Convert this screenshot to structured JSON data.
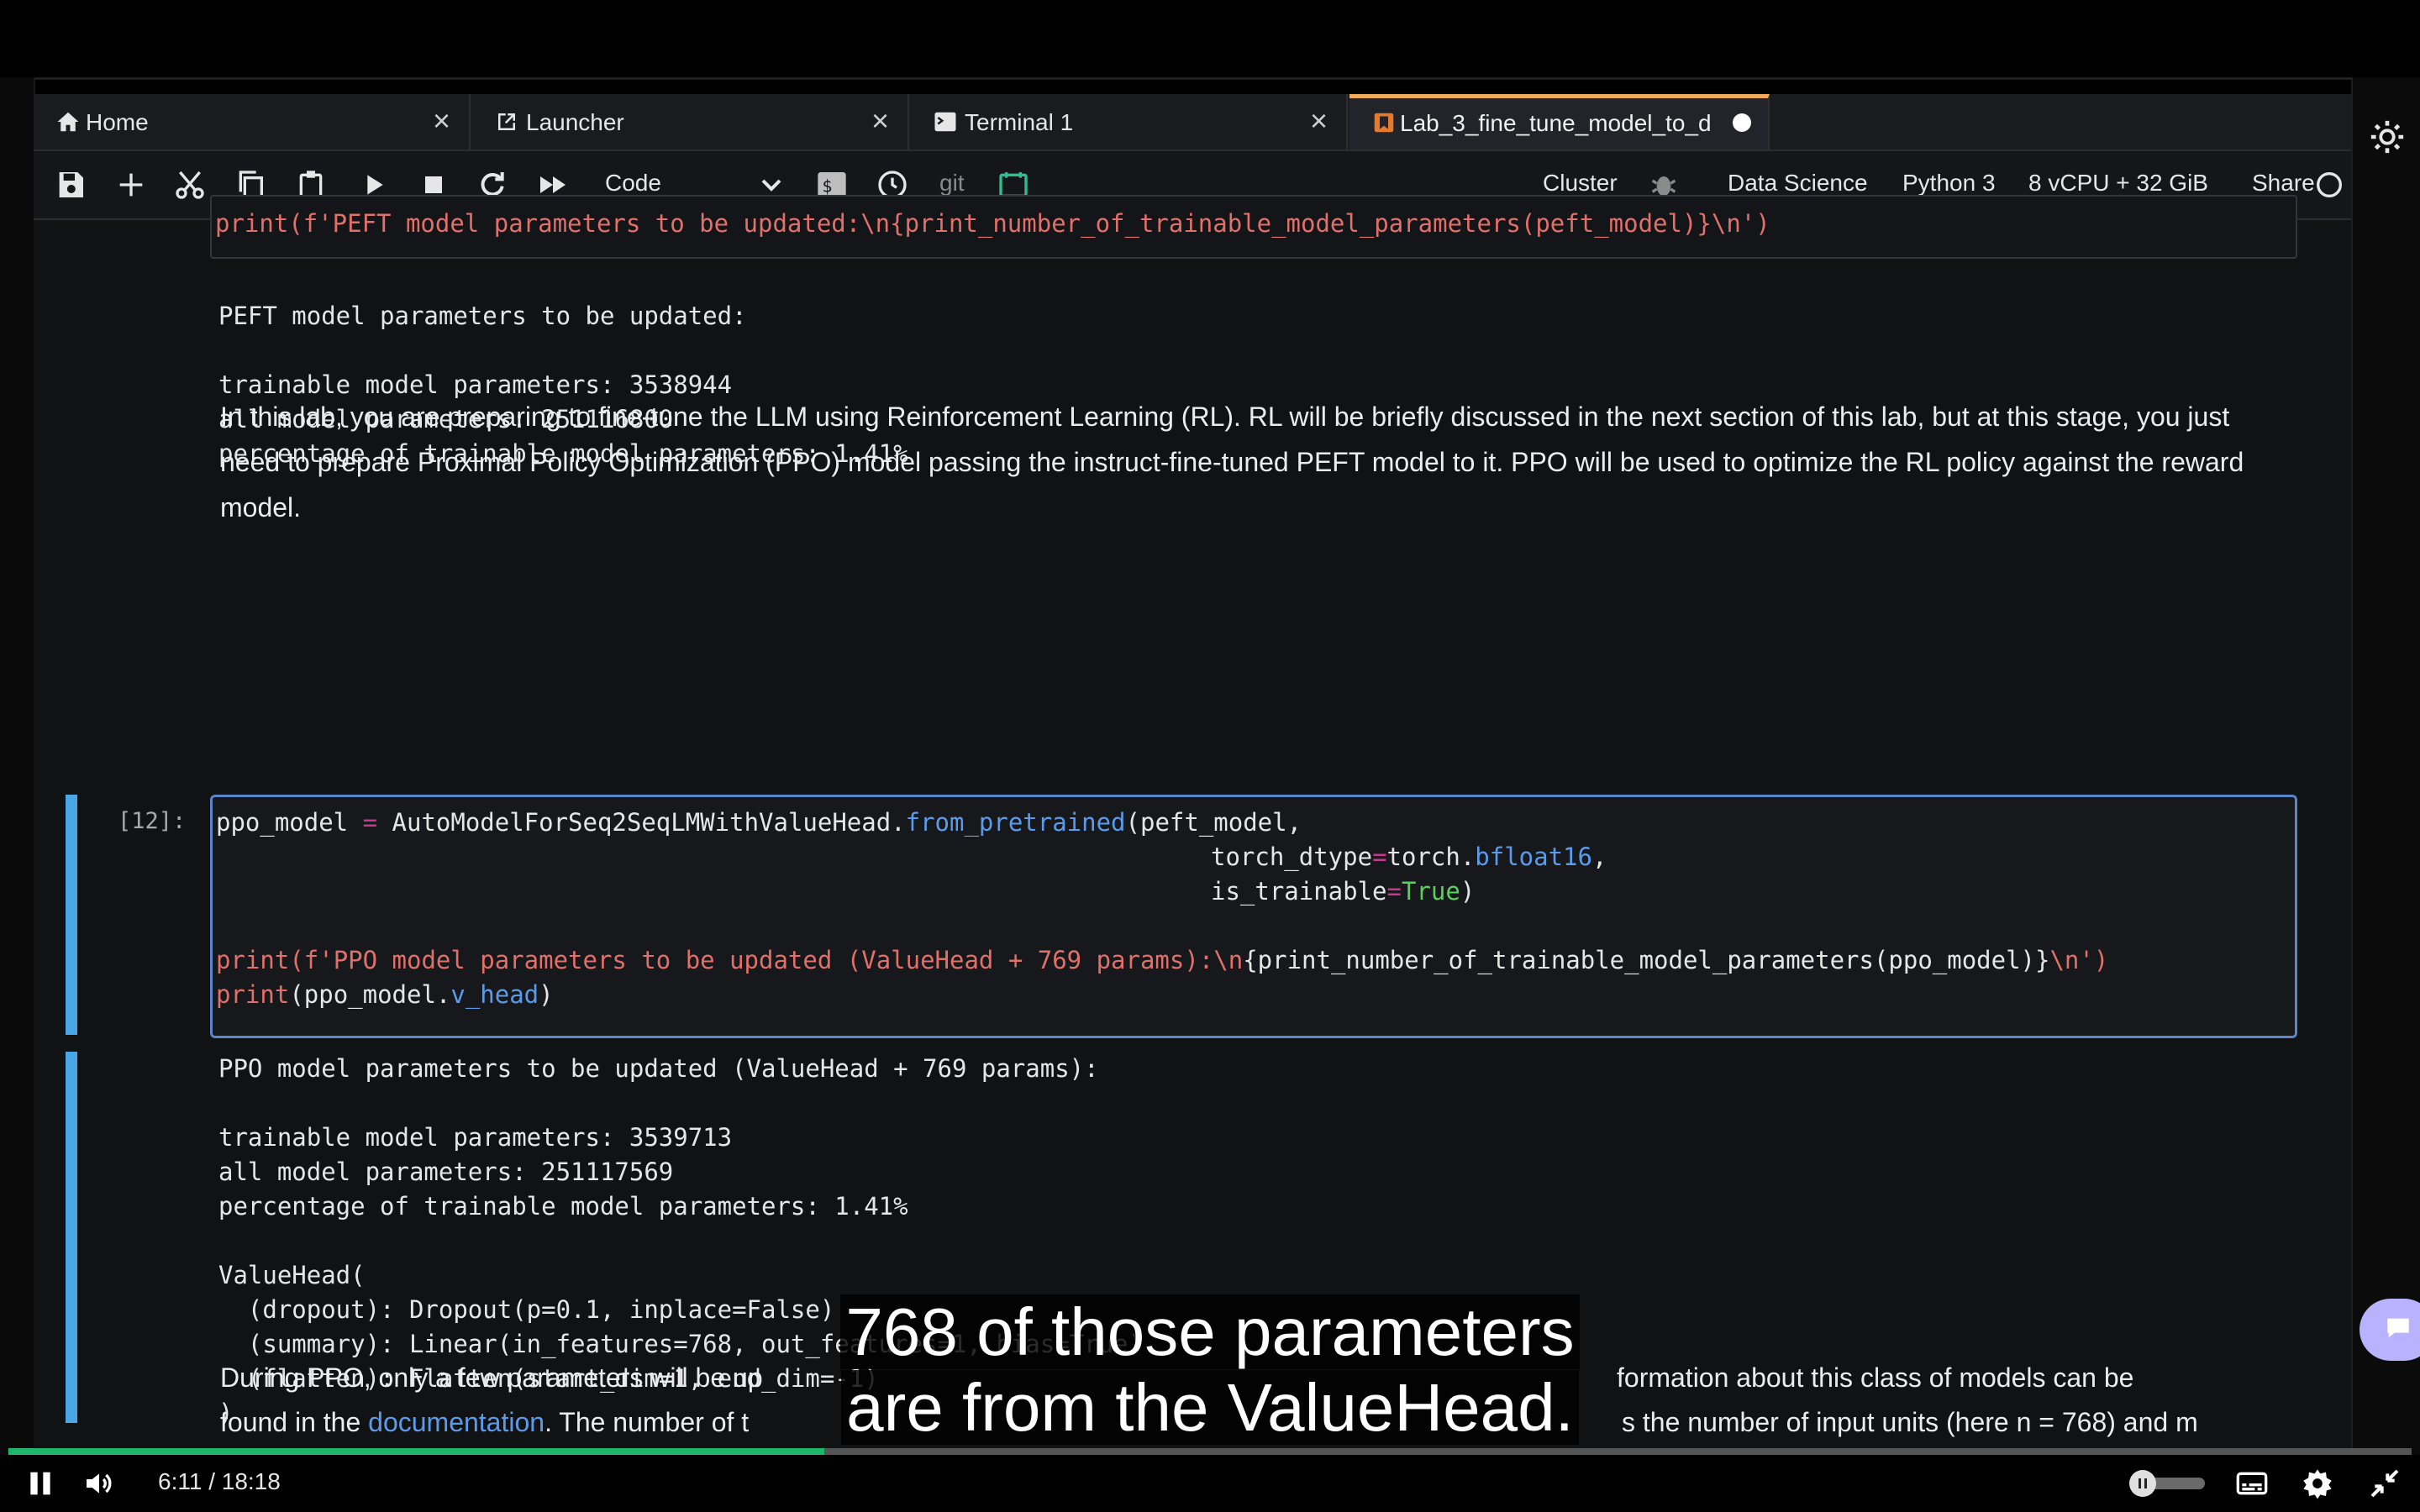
{
  "tabs": [
    {
      "label": "Home",
      "icon": "home-icon"
    },
    {
      "label": "Launcher",
      "icon": "external-link-icon"
    },
    {
      "label": "Terminal 1",
      "icon": "terminal-icon"
    },
    {
      "label": "Lab_3_fine_tune_model_to_d",
      "icon": "notebook-icon",
      "active": true
    }
  ],
  "toolbar": {
    "cell_type": "Code",
    "git_label": "git",
    "cluster": "Cluster",
    "kernel_image": "Data Science",
    "kernel": "Python 3",
    "instance": "8 vCPU + 32 GiB",
    "share": "Share"
  },
  "prev_cell": {
    "code": "print(f'PEFT model parameters to be updated:\\n{print_number_of_trainable_model_parameters(peft_model)}\\n')"
  },
  "output1": {
    "line1": "PEFT model parameters to be updated:",
    "line2": "trainable model parameters: 3538944",
    "line3": "all model parameters: 251116800",
    "line4": "percentage of trainable model parameters: 1.41%"
  },
  "markdown1": "In this lab, you are preparing to fine-tune the LLM using Reinforcement Learning (RL). RL will be briefly discussed in the next section of this lab, but at this stage, you just need to prepare Proximal Policy Optimization (PPO) model passing the instruct-fine-tuned PEFT model to it. PPO will be used to optimize the RL policy against the reward model.",
  "cell12": {
    "prompt": "[12]:",
    "l1_a": "ppo_model ",
    "l1_eq": "=",
    "l1_b": " AutoModelForSeq2SeqLMWithValueHead.",
    "l1_fn": "from_pretrained",
    "l1_c": "(peft_model,",
    "l2_a": "torch_dtype",
    "l2_eq": "=",
    "l2_b": "torch.",
    "l2_fn": "bfloat16",
    "l2_c": ",",
    "l3_a": "is_trainable",
    "l3_eq": "=",
    "l3_b": "True",
    "l3_c": ")",
    "l4_print": "print",
    "l4_str": "(f'PPO model parameters to be updated (ValueHead + 769 params):\\n",
    "l4_rest": "{print_number_of_trainable_model_parameters(ppo_model)}",
    "l4_end": "\\n')",
    "l5_print": "print",
    "l5_a": "(ppo_model.",
    "l5_fn": "v_head",
    "l5_c": ")"
  },
  "output12": {
    "line1": "PPO model parameters to be updated (ValueHead + 769 params):",
    "line2": "trainable model parameters: 3539713",
    "line3": "all model parameters: 251117569",
    "line4": "percentage of trainable model parameters: 1.41%",
    "line5": "ValueHead(",
    "line6": "  (dropout): Dropout(p=0.1, inplace=False)",
    "line7": "  (summary): Linear(in_features=768, out_features=1, bias=True)",
    "line8": "  (flatten): Flatten(start_dim=1, end_dim=-1)",
    "line9": ")"
  },
  "markdown2": {
    "line1_a": "During PPO, only a few parameters will be up",
    "line1_b": "formation about this class of models can be",
    "line2_a": "found in the ",
    "line2_link": "documentation",
    "line2_b": ". The number of t",
    "line2_c": "s the number of input units (here n = 768) and m"
  },
  "subtitle": {
    "line1": "768 of those parameters",
    "line2": "are from the ValueHead."
  },
  "player": {
    "time": "6:11  /  18:18",
    "progress": 0.3394,
    "colors": {
      "progress": "#1fb66b"
    }
  }
}
